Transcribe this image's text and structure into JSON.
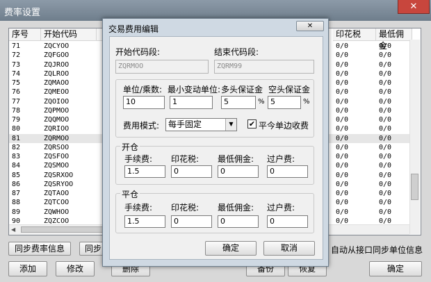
{
  "window": {
    "title": "费率设置",
    "close_glyph": "✕"
  },
  "table": {
    "headers": [
      "序号",
      "开始代码",
      "",
      "印花税",
      "最低佣金"
    ],
    "rows": [
      {
        "no": "71",
        "code": "ZQCYOO",
        "stamp": "0/0",
        "min": "0/0"
      },
      {
        "no": "72",
        "code": "ZQFGOO",
        "stamp": "0/0",
        "min": "0/0"
      },
      {
        "no": "73",
        "code": "ZQJROO",
        "stamp": "0/0",
        "min": "0/0"
      },
      {
        "no": "74",
        "code": "ZQLROO",
        "stamp": "0/0",
        "min": "0/0"
      },
      {
        "no": "75",
        "code": "ZQMAOO",
        "stamp": "0/0",
        "min": "0/0"
      },
      {
        "no": "76",
        "code": "ZQMEOO",
        "stamp": "0/0",
        "min": "0/0"
      },
      {
        "no": "77",
        "code": "ZQOIOO",
        "stamp": "0/0",
        "min": "0/0"
      },
      {
        "no": "78",
        "code": "ZQPMOO",
        "stamp": "0/0",
        "min": "0/0"
      },
      {
        "no": "79",
        "code": "ZQQMOO",
        "stamp": "0/0",
        "min": "0/0"
      },
      {
        "no": "80",
        "code": "ZQRIOO",
        "stamp": "0/0",
        "min": "0/0"
      },
      {
        "no": "81",
        "code": "ZQRMOO",
        "stamp": "0/0",
        "min": "0/0"
      },
      {
        "no": "82",
        "code": "ZQRSOO",
        "stamp": "0/0",
        "min": "0/0"
      },
      {
        "no": "83",
        "code": "ZQSFOO",
        "stamp": "0/0",
        "min": "0/0"
      },
      {
        "no": "84",
        "code": "ZQSMOO",
        "stamp": "0/0",
        "min": "0/0"
      },
      {
        "no": "85",
        "code": "ZQSRXOO",
        "stamp": "0/0",
        "min": "0/0"
      },
      {
        "no": "86",
        "code": "ZQSRYOO",
        "stamp": "0/0",
        "min": "0/0"
      },
      {
        "no": "87",
        "code": "ZQTAOO",
        "stamp": "0/0",
        "min": "0/0"
      },
      {
        "no": "88",
        "code": "ZQTCOO",
        "stamp": "0/0",
        "min": "0/0"
      },
      {
        "no": "89",
        "code": "ZQWHOO",
        "stamp": "0/0",
        "min": "0/0"
      },
      {
        "no": "90",
        "code": "ZQZCOO",
        "stamp": "0/0",
        "min": "0/0"
      }
    ],
    "selected_index": 10
  },
  "buttons_row1": {
    "sync_rate": "同步费率信息",
    "sync_other": "同步",
    "auto_sync": "自动从接口同步单位信息"
  },
  "buttons_row2": {
    "add": "添加",
    "modify": "修改",
    "delete": "删除",
    "save": "备份",
    "restore": "恢复",
    "ok": "确定"
  },
  "dialog": {
    "title": "交易费用编辑",
    "close_glyph": "✕",
    "start_code_label": "开始代码段:",
    "end_code_label": "结束代码段:",
    "start_code": "ZQRMOO",
    "end_code": "ZQRM99",
    "unit_label": "单位/乘数:",
    "tick_label": "最小变动单位:",
    "long_margin_label": "多头保证金",
    "short_margin_label": "空头保证金",
    "unit": "10",
    "tick": "1",
    "long_margin": "5",
    "short_margin": "5",
    "percent": "%",
    "fee_mode_label": "费用模式:",
    "fee_mode": "每手固定",
    "close_today_label": "平今单边收费",
    "close_today_checked": true,
    "open": {
      "title": "开仓",
      "fee_label": "手续费:",
      "stamp_label": "印花税:",
      "min_label": "最低佣金:",
      "transfer_label": "过户费:",
      "fee": "1.5",
      "stamp": "0",
      "min": "0",
      "transfer": "0"
    },
    "close": {
      "title": "平仓",
      "fee_label": "手续费:",
      "stamp_label": "印花税:",
      "min_label": "最低佣金:",
      "transfer_label": "过户费:",
      "fee": "1.5",
      "stamp": "0",
      "min": "0",
      "transfer": "0"
    },
    "ok_label": "确定",
    "cancel_label": "取消"
  }
}
